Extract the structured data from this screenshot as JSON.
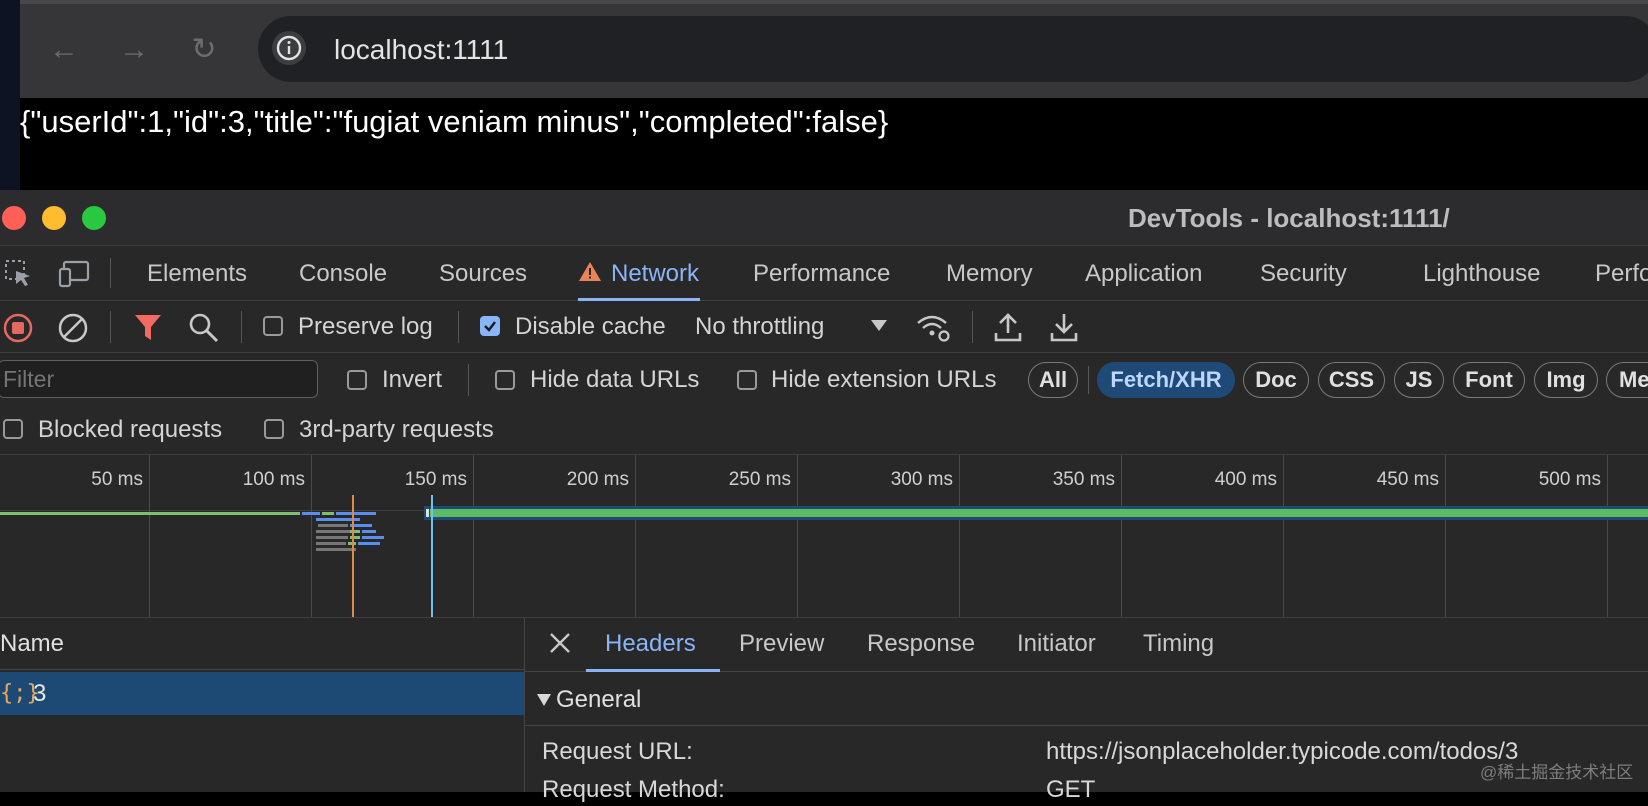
{
  "browser": {
    "url": "localhost:1111",
    "page_content": "{\"userId\":1,\"id\":3,\"title\":\"fugiat veniam minus\",\"completed\":false}"
  },
  "devtools": {
    "title": "DevTools - localhost:1111/",
    "tabs": [
      "Elements",
      "Console",
      "Sources",
      "Network",
      "Performance",
      "Memory",
      "Application",
      "Security",
      "Lighthouse",
      "Perfo"
    ],
    "active_tab": "Network",
    "toolbar": {
      "preserve_log": "Preserve log",
      "disable_cache": "Disable cache",
      "throttling": "No throttling"
    },
    "filter": {
      "placeholder": "Filter",
      "invert": "Invert",
      "hide_data_urls": "Hide data URLs",
      "hide_extension_urls": "Hide extension URLs",
      "chips": [
        "All",
        "Fetch/XHR",
        "Doc",
        "CSS",
        "JS",
        "Font",
        "Img",
        "Me"
      ],
      "active_chip": "Fetch/XHR",
      "blocked_requests": "Blocked requests",
      "third_party": "3rd-party requests"
    },
    "timeline": {
      "ticks": [
        "50 ms",
        "100 ms",
        "150 ms",
        "200 ms",
        "250 ms",
        "300 ms",
        "350 ms",
        "400 ms",
        "450 ms",
        "500 ms"
      ]
    },
    "requests": {
      "column": "Name",
      "rows": [
        {
          "icon": "{;}",
          "name": "3"
        }
      ]
    },
    "detail": {
      "tabs": [
        "Headers",
        "Preview",
        "Response",
        "Initiator",
        "Timing"
      ],
      "active_tab": "Headers",
      "section": "General",
      "request_url_label": "Request URL:",
      "request_url_value": "https://jsonplaceholder.typicode.com/todos/3",
      "request_method_label": "Request Method:",
      "request_method_value": "GET"
    },
    "watermark": "@稀土掘金技术社区"
  },
  "colors": {
    "accent": "#8ab4f8",
    "selected_row": "#1c4a74",
    "traffic_red": "#ff5f57",
    "traffic_yellow": "#febc2e",
    "traffic_green": "#28c840",
    "record_red": "#e46962",
    "filter_red": "#f16b63"
  }
}
